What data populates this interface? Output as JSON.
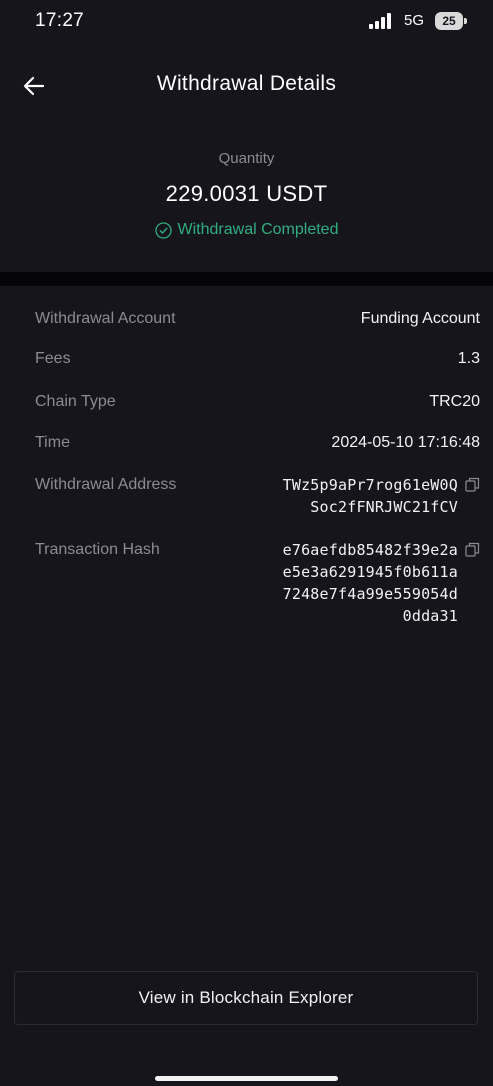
{
  "status_bar": {
    "time": "17:27",
    "network": "5G",
    "battery": "25"
  },
  "header": {
    "title": "Withdrawal Details"
  },
  "summary": {
    "quantity_label": "Quantity",
    "quantity_value": "229.0031 USDT",
    "status": "Withdrawal Completed"
  },
  "details": {
    "withdrawal_account": {
      "label": "Withdrawal Account",
      "value": "Funding Account"
    },
    "fees": {
      "label": "Fees",
      "value": "1.3"
    },
    "chain_type": {
      "label": "Chain Type",
      "value": "TRC20"
    },
    "time": {
      "label": "Time",
      "value": "2024-05-10 17:16:48"
    },
    "withdrawal_address": {
      "label": "Withdrawal Address",
      "value": "TWz5p9aPr7rog61eW0QSoc2fFNRJWC21fCV"
    },
    "transaction_hash": {
      "label": "Transaction Hash",
      "value": "e76aefdb85482f39e2ae5e3a6291945f0b611a7248e7f4a99e559054d0dda31"
    }
  },
  "explorer_button": {
    "label": "View in Blockchain Explorer"
  },
  "colors": {
    "background": "#16151b",
    "success": "#2fae7e",
    "muted_text": "#8b8b93",
    "divider": "#050507"
  }
}
